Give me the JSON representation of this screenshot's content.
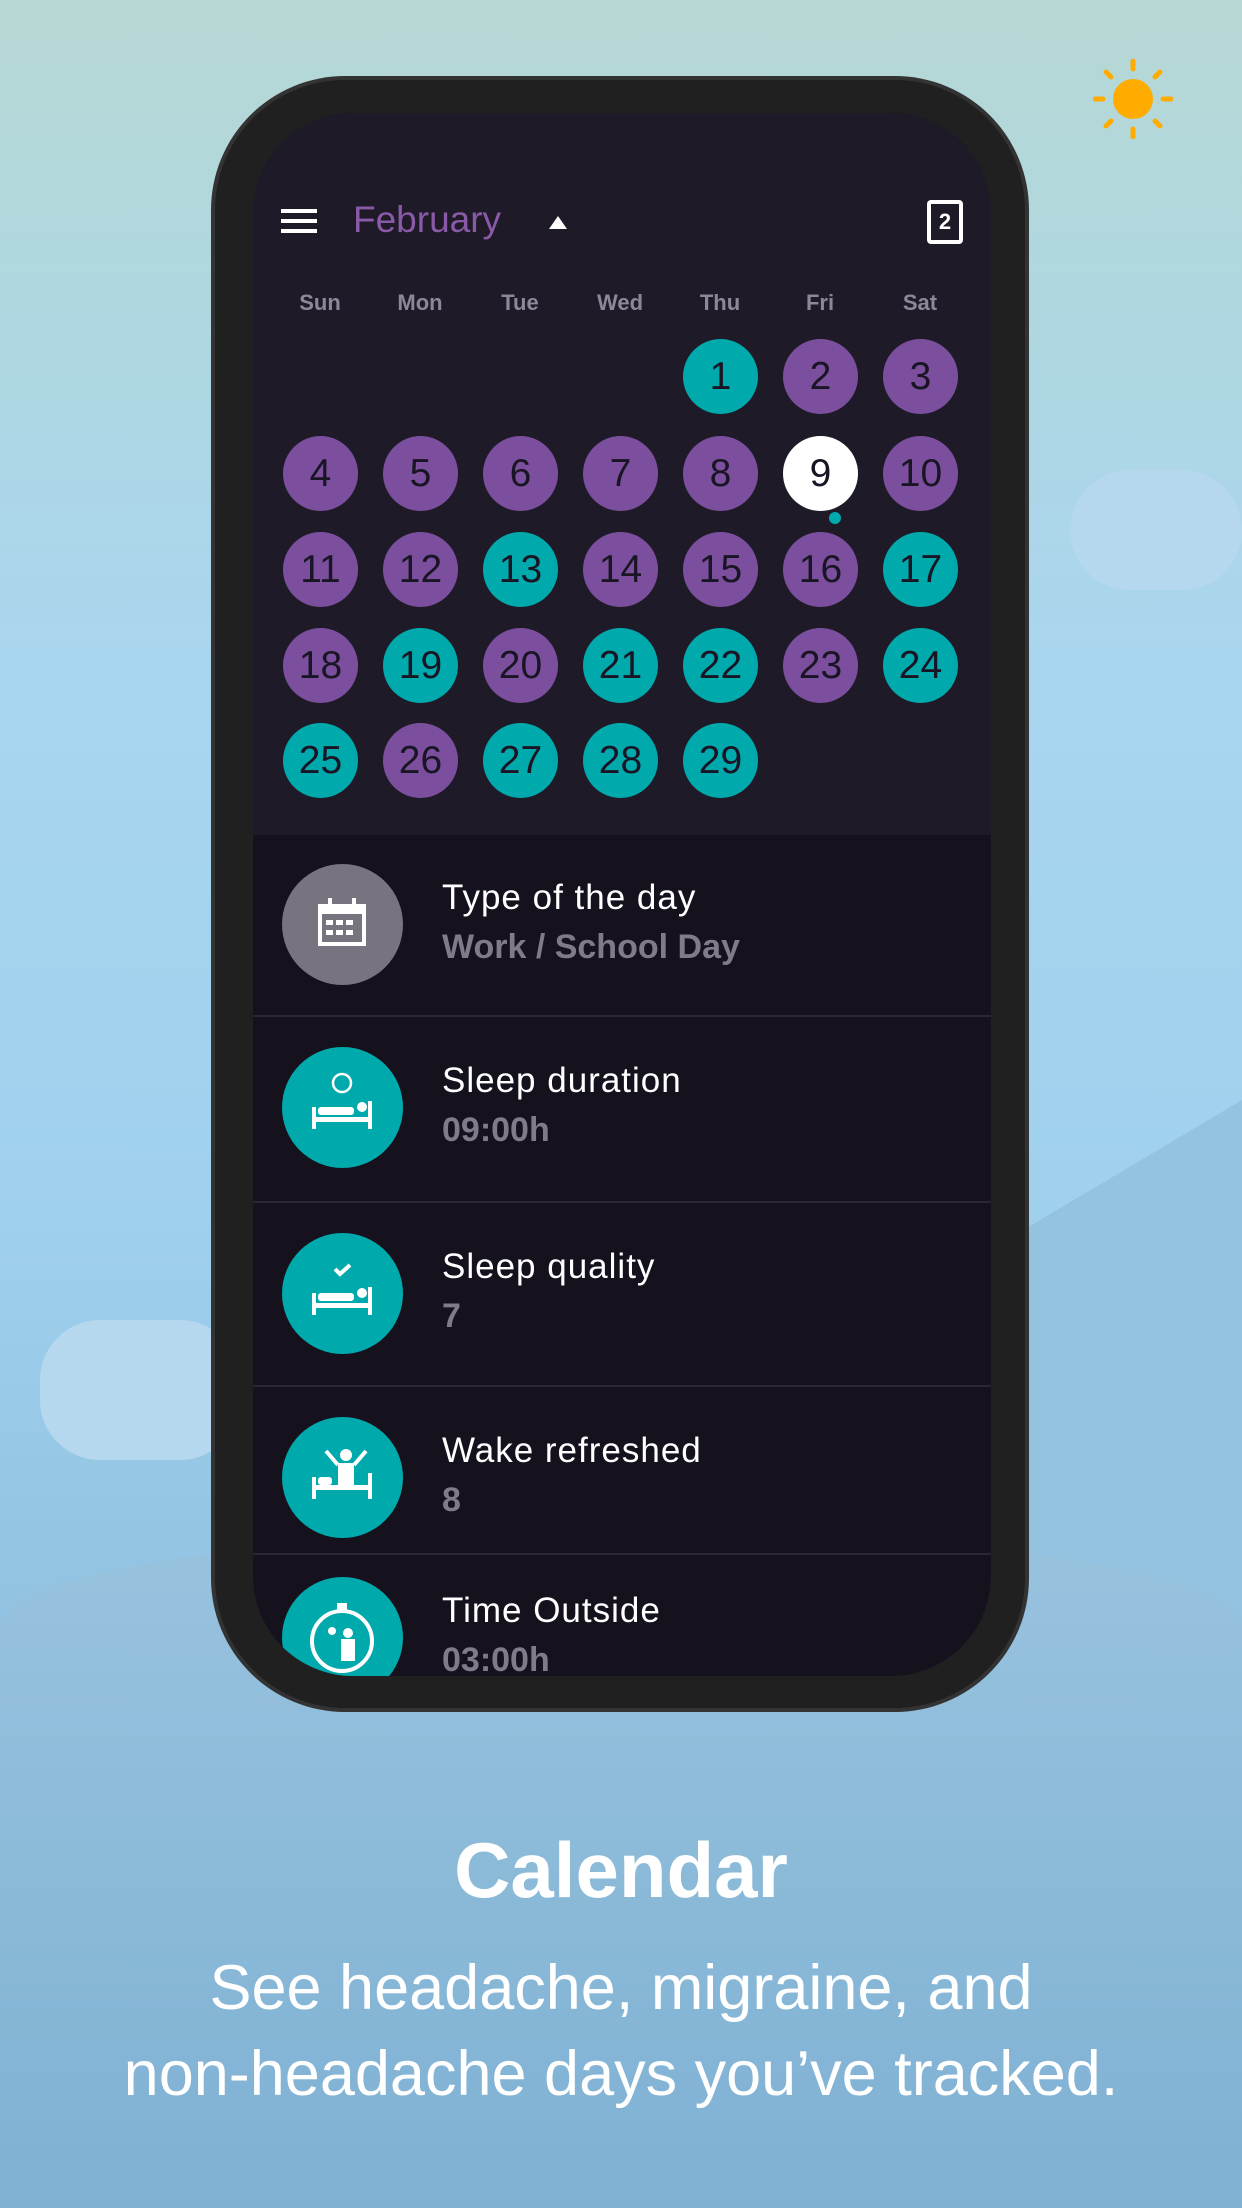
{
  "colors": {
    "teal": "#00a9ac",
    "purple": "#7b4f9e",
    "today": "#ffffff",
    "accent_month": "#8a5aa8"
  },
  "header": {
    "menu_icon": "hamburger-icon",
    "month": "February",
    "toggle_icon": "triangle-up-icon",
    "today_icon": "calendar-today-icon",
    "today_number": "2"
  },
  "weekdays": [
    "Sun",
    "Mon",
    "Tue",
    "Wed",
    "Thu",
    "Fri",
    "Sat"
  ],
  "first_weekday_index": 4,
  "days": [
    {
      "n": "1",
      "type": "teal"
    },
    {
      "n": "2",
      "type": "purple"
    },
    {
      "n": "3",
      "type": "purple"
    },
    {
      "n": "4",
      "type": "purple"
    },
    {
      "n": "5",
      "type": "purple"
    },
    {
      "n": "6",
      "type": "purple"
    },
    {
      "n": "7",
      "type": "purple"
    },
    {
      "n": "8",
      "type": "purple"
    },
    {
      "n": "9",
      "type": "today"
    },
    {
      "n": "10",
      "type": "purple"
    },
    {
      "n": "11",
      "type": "purple"
    },
    {
      "n": "12",
      "type": "purple"
    },
    {
      "n": "13",
      "type": "teal"
    },
    {
      "n": "14",
      "type": "purple"
    },
    {
      "n": "15",
      "type": "purple"
    },
    {
      "n": "16",
      "type": "purple"
    },
    {
      "n": "17",
      "type": "teal"
    },
    {
      "n": "18",
      "type": "purple"
    },
    {
      "n": "19",
      "type": "teal"
    },
    {
      "n": "20",
      "type": "purple"
    },
    {
      "n": "21",
      "type": "teal"
    },
    {
      "n": "22",
      "type": "teal"
    },
    {
      "n": "23",
      "type": "purple"
    },
    {
      "n": "24",
      "type": "teal"
    },
    {
      "n": "25",
      "type": "teal"
    },
    {
      "n": "26",
      "type": "purple"
    },
    {
      "n": "27",
      "type": "teal"
    },
    {
      "n": "28",
      "type": "teal"
    },
    {
      "n": "29",
      "type": "teal"
    }
  ],
  "details": [
    {
      "title": "Type of the day",
      "value": "Work / School Day",
      "icon": "calendar-grid-icon"
    },
    {
      "title": "Sleep duration",
      "value": "09:00h",
      "icon": "bed-clock-icon"
    },
    {
      "title": "Sleep quality",
      "value": "7",
      "icon": "bed-check-icon"
    },
    {
      "title": "Wake refreshed",
      "value": "8",
      "icon": "person-waking-icon"
    },
    {
      "title": "Time Outside",
      "value": "03:00h",
      "icon": "stopwatch-person-icon"
    }
  ],
  "caption": {
    "title": "Calendar",
    "line1": "See headache, migraine, and",
    "line2": "non-headache days you’ve tracked."
  }
}
